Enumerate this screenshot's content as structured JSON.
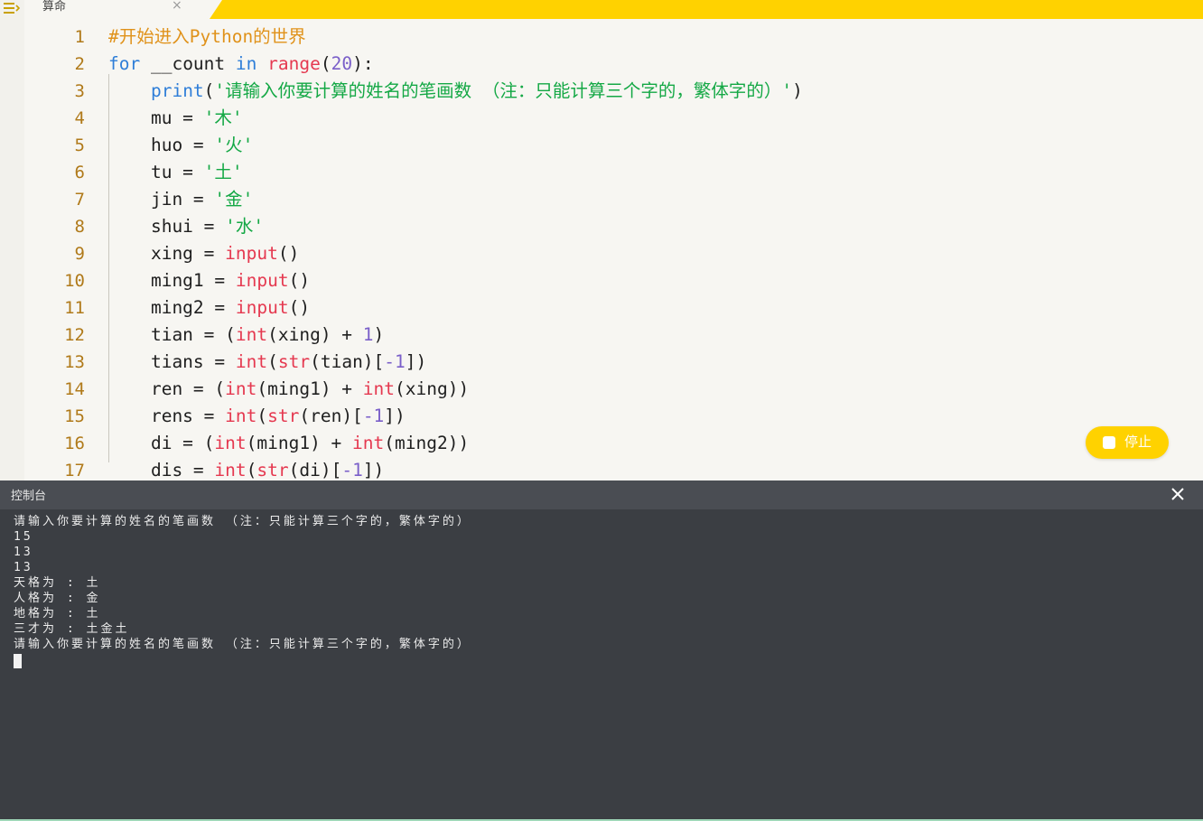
{
  "app": {
    "tab_title": "算命",
    "tab_close": "×"
  },
  "editor": {
    "line_numbers": [
      "1",
      "2",
      "3",
      "4",
      "5",
      "6",
      "7",
      "8",
      "9",
      "10",
      "11",
      "12",
      "13",
      "14",
      "15",
      "16",
      "17"
    ],
    "lines": [
      [
        {
          "t": "#开始进入Python的世界",
          "c": "com"
        }
      ],
      [
        {
          "t": "for",
          "c": "kw"
        },
        {
          "t": " __count "
        },
        {
          "t": "in",
          "c": "kw"
        },
        {
          "t": " "
        },
        {
          "t": "range",
          "c": "bi"
        },
        {
          "t": "("
        },
        {
          "t": "20",
          "c": "num"
        },
        {
          "t": "):"
        }
      ],
      [
        {
          "t": "    "
        },
        {
          "t": "print",
          "c": "kw"
        },
        {
          "t": "("
        },
        {
          "t": "'请输入你要计算的姓名的笔画数 （注：只能计算三个字的，繁体字的）'",
          "c": "str"
        },
        {
          "t": ")"
        }
      ],
      [
        {
          "t": "    mu = "
        },
        {
          "t": "'木'",
          "c": "str"
        }
      ],
      [
        {
          "t": "    huo = "
        },
        {
          "t": "'火'",
          "c": "str"
        }
      ],
      [
        {
          "t": "    tu = "
        },
        {
          "t": "'土'",
          "c": "str"
        }
      ],
      [
        {
          "t": "    jin = "
        },
        {
          "t": "'金'",
          "c": "str"
        }
      ],
      [
        {
          "t": "    shui = "
        },
        {
          "t": "'水'",
          "c": "str"
        }
      ],
      [
        {
          "t": "    xing = "
        },
        {
          "t": "input",
          "c": "bi"
        },
        {
          "t": "()"
        }
      ],
      [
        {
          "t": "    ming1 = "
        },
        {
          "t": "input",
          "c": "bi"
        },
        {
          "t": "()"
        }
      ],
      [
        {
          "t": "    ming2 = "
        },
        {
          "t": "input",
          "c": "bi"
        },
        {
          "t": "()"
        }
      ],
      [
        {
          "t": "    tian = ("
        },
        {
          "t": "int",
          "c": "bi"
        },
        {
          "t": "(xing) + "
        },
        {
          "t": "1",
          "c": "num"
        },
        {
          "t": ")"
        }
      ],
      [
        {
          "t": "    tians = "
        },
        {
          "t": "int",
          "c": "bi"
        },
        {
          "t": "("
        },
        {
          "t": "str",
          "c": "bi"
        },
        {
          "t": "(tian)["
        },
        {
          "t": "-1",
          "c": "num"
        },
        {
          "t": "])"
        }
      ],
      [
        {
          "t": "    ren = ("
        },
        {
          "t": "int",
          "c": "bi"
        },
        {
          "t": "(ming1) + "
        },
        {
          "t": "int",
          "c": "bi"
        },
        {
          "t": "(xing))"
        }
      ],
      [
        {
          "t": "    rens = "
        },
        {
          "t": "int",
          "c": "bi"
        },
        {
          "t": "("
        },
        {
          "t": "str",
          "c": "bi"
        },
        {
          "t": "(ren)["
        },
        {
          "t": "-1",
          "c": "num"
        },
        {
          "t": "])"
        }
      ],
      [
        {
          "t": "    di = ("
        },
        {
          "t": "int",
          "c": "bi"
        },
        {
          "t": "(ming1) + "
        },
        {
          "t": "int",
          "c": "bi"
        },
        {
          "t": "(ming2))"
        }
      ],
      [
        {
          "t": "    dis = "
        },
        {
          "t": "int",
          "c": "bi"
        },
        {
          "t": "("
        },
        {
          "t": "str",
          "c": "bi"
        },
        {
          "t": "(di)["
        },
        {
          "t": "-1",
          "c": "num"
        },
        {
          "t": "])"
        }
      ]
    ]
  },
  "stop_button": {
    "label": "停止"
  },
  "console": {
    "title": "控制台",
    "close": "×",
    "output": [
      "请输入你要计算的姓名的笔画数 （注：只能计算三个字的，繁体字的）",
      "15",
      "13",
      "13",
      "天格为 : 土",
      "人格为 : 金",
      "地格为 : 土",
      "三才为 : 土金土",
      "请输入你要计算的姓名的笔画数 （注：只能计算三个字的，繁体字的）"
    ]
  },
  "colors": {
    "accent": "#ffd200",
    "keyword": "#2f7ed8",
    "builtin": "#e53950",
    "string": "#14a845",
    "number": "#7a5fc9",
    "comment": "#e0921a",
    "console_bg": "#3b3e43"
  },
  "icons": {
    "rail": "menu-collapse-icon",
    "stop": "stop-square-icon",
    "console_close": "close-icon"
  }
}
